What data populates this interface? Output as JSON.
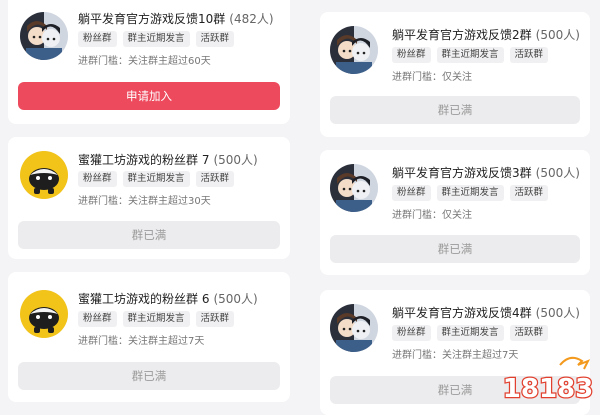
{
  "groups_left": [
    {
      "name": "躺平发育官方游戏反馈10群",
      "count": "(482人)",
      "avatar": "game-character-avatar",
      "tags": [
        "粉丝群",
        "群主近期发言",
        "活跃群"
      ],
      "threshold": "进群门槛：关注群主超过60天",
      "button": "申请加入",
      "button_state": "join"
    },
    {
      "name": "蜜獾工坊游戏的粉丝群 7",
      "count": "(500人)",
      "avatar": "honey-badger-avatar",
      "tags": [
        "粉丝群",
        "群主近期发言",
        "活跃群"
      ],
      "threshold": "进群门槛：关注群主超过30天",
      "button": "群已满",
      "button_state": "full"
    },
    {
      "name": "蜜獾工坊游戏的粉丝群 6",
      "count": "(500人)",
      "avatar": "honey-badger-avatar",
      "tags": [
        "粉丝群",
        "群主近期发言",
        "活跃群"
      ],
      "threshold": "进群门槛：关注群主超过7天",
      "button": "群已满",
      "button_state": "full"
    }
  ],
  "groups_right": [
    {
      "name": "躺平发育官方游戏反馈2群",
      "count": "(500人)",
      "avatar": "game-character-avatar",
      "tags": [
        "粉丝群",
        "群主近期发言",
        "活跃群"
      ],
      "threshold": "进群门槛：仅关注",
      "button": "群已满",
      "button_state": "full"
    },
    {
      "name": "躺平发育官方游戏反馈3群",
      "count": "(500人)",
      "avatar": "game-character-avatar",
      "tags": [
        "粉丝群",
        "群主近期发言",
        "活跃群"
      ],
      "threshold": "进群门槛：仅关注",
      "button": "群已满",
      "button_state": "full"
    },
    {
      "name": "躺平发育官方游戏反馈4群",
      "count": "(500人)",
      "avatar": "game-character-avatar",
      "tags": [
        "粉丝群",
        "群主近期发言",
        "活跃群"
      ],
      "threshold": "进群门槛：关注群主超过7天",
      "button": "群已满",
      "button_state": "full"
    }
  ],
  "watermark": "18183",
  "colors": {
    "join_button": "#ed4a5e",
    "full_button": "#ececee",
    "badger_bg": "#f2c318"
  }
}
